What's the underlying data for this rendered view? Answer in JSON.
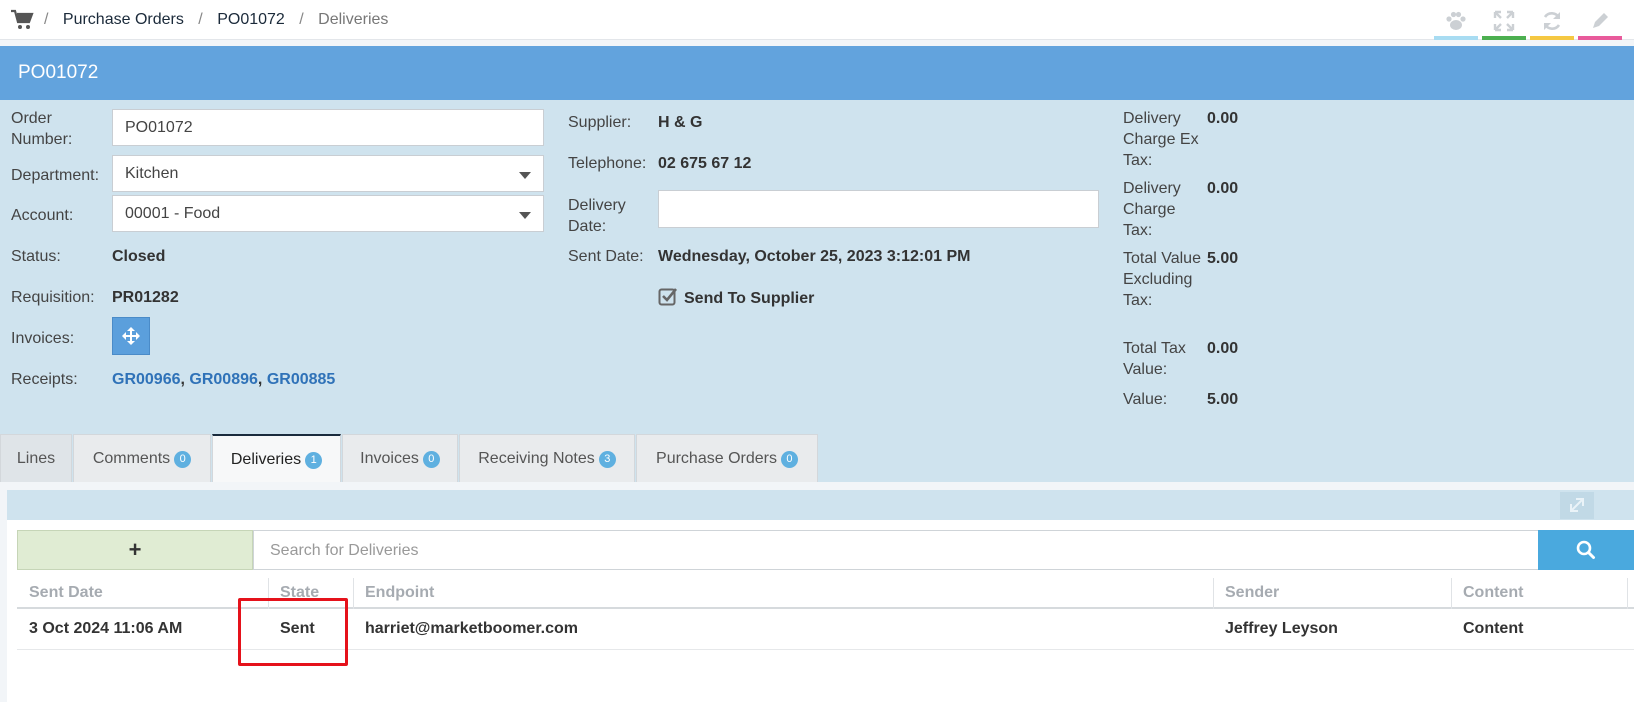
{
  "breadcrumb": {
    "items": [
      "Purchase Orders",
      "PO01072"
    ],
    "current": "Deliveries",
    "separator": "/"
  },
  "toolbar": {
    "tools": [
      {
        "icon": "paw-icon",
        "color": "#a8dcf2"
      },
      {
        "icon": "expand-icon",
        "color": "#4caf50"
      },
      {
        "icon": "refresh-icon",
        "color": "#f5c842"
      },
      {
        "icon": "edit-icon",
        "color": "#e85a9b"
      }
    ]
  },
  "header": {
    "title": "PO01072"
  },
  "form": {
    "order_number_label": "Order Number:",
    "order_number_value": "PO01072",
    "department_label": "Department:",
    "department_value": "Kitchen",
    "account_label": "Account:",
    "account_value": "00001 - Food",
    "status_label": "Status:",
    "status_value": "Closed",
    "requisition_label": "Requisition:",
    "requisition_value": "PR01282",
    "invoices_label": "Invoices:",
    "receipts_label": "Receipts:",
    "receipts": [
      "GR00966",
      "GR00896",
      "GR00885"
    ],
    "receipt_separator": ",",
    "supplier_label": "Supplier:",
    "supplier_value": "H & G",
    "telephone_label": "Telephone:",
    "telephone_value": "02 675 67 12",
    "delivery_date_label": "Delivery Date:",
    "delivery_date_value": "",
    "sent_date_label": "Sent Date:",
    "sent_date_value": "Wednesday, October 25, 2023 3:12:01 PM",
    "send_to_supplier_label": "Send To Supplier",
    "send_to_supplier_checked": true
  },
  "totals": {
    "delivery_charge_ex_tax_label": "Delivery Charge Ex Tax:",
    "delivery_charge_ex_tax_value": "0.00",
    "delivery_charge_tax_label": "Delivery Charge Tax:",
    "delivery_charge_tax_value": "0.00",
    "total_value_excl_tax_label": "Total Value Excluding Tax:",
    "total_value_excl_tax_value": "5.00",
    "total_tax_value_label": "Total Tax Value:",
    "total_tax_value_value": "0.00",
    "value_label": "Value:",
    "value_value": "5.00"
  },
  "tabs": [
    {
      "label": "Lines"
    },
    {
      "label": "Comments",
      "count": "0"
    },
    {
      "label": "Deliveries",
      "count": "1",
      "active": true
    },
    {
      "label": "Invoices",
      "count": "0"
    },
    {
      "label": "Receiving Notes",
      "count": "3"
    },
    {
      "label": "Purchase Orders",
      "count": "0"
    }
  ],
  "deliveries": {
    "add_label": "+",
    "search_placeholder": "Search for Deliveries",
    "columns": [
      "Sent Date",
      "State",
      "Endpoint",
      "Sender",
      "Content"
    ],
    "rows": [
      {
        "sent_date": "3 Oct 2024 11:06 AM",
        "state": "Sent",
        "endpoint": "harriet@marketboomer.com",
        "sender": "Jeffrey Leyson",
        "content": "Content"
      }
    ]
  },
  "colors": {
    "header": "#62a3dd",
    "panel": "#cfe3ee",
    "link": "#2f72b8",
    "highlight": "#e5121b",
    "add_button": "#e0ecd3",
    "search_button": "#4aa9de"
  }
}
